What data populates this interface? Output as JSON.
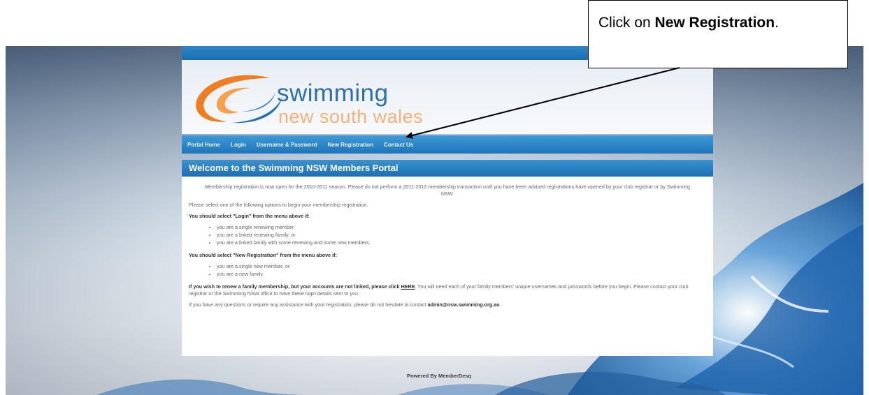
{
  "annotation": {
    "prefix": "Click on ",
    "bold": "New Registration",
    "suffix": "."
  },
  "portal": {
    "logo_line1": "swimming",
    "logo_line2": "new south wales",
    "menu": [
      {
        "label": "Portal Home"
      },
      {
        "label": "Login"
      },
      {
        "label": "Username & Password"
      },
      {
        "label": "New Registration"
      },
      {
        "label": "Contact Us"
      }
    ],
    "welcome_title": "Welcome to the Swimming NSW Members Portal",
    "intro": "Membership registration is now open for the 2010-2011 season. Please do not perform a 2011-2012 membership transaction until you have been advised registrations have opened by your club registrar or by Swimming NSW.",
    "select_prompt": "Please select one of the following options to begin your membership registration.",
    "login_heading": "You should select \"Login\" from the menu above if:",
    "login_items": [
      "you are a single renewing member",
      "you are a linked renewing family, or",
      "you are a linked family with some renewing and some new members."
    ],
    "newreg_heading": "You should select \"New Registration\" from the menu above if:",
    "newreg_items": [
      "you are a single new member, or",
      "you are a new family."
    ],
    "family_bold": "If you wish to renew a family membership, but your accounts are not linked, please click ",
    "family_link": "HERE",
    "family_rest": ". You will need each of your family members' unique usernames and passwords before you begin. Please contact your club registrar or the Swimming NSW office to have these login details sent to you.",
    "help_text": "If you have any questions or require any assistance with your registration, please do not hesitate to contact ",
    "help_email": "admin@nsw.swimming.org.au",
    "footer": "Powered By MemberDesq"
  }
}
